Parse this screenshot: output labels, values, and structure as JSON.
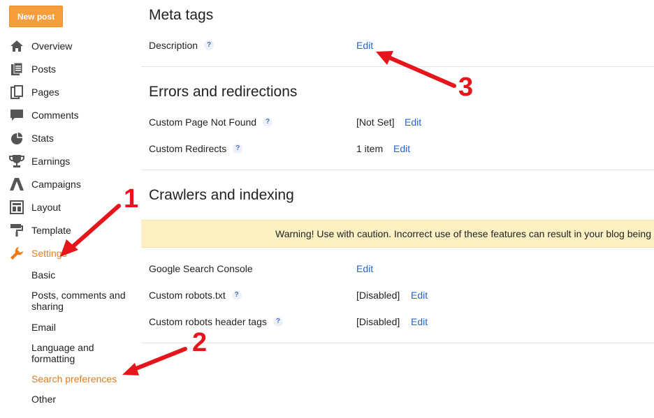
{
  "sidebar": {
    "new_post": "New post",
    "items": [
      {
        "label": "Overview",
        "icon": "home-icon"
      },
      {
        "label": "Posts",
        "icon": "posts-icon"
      },
      {
        "label": "Pages",
        "icon": "pages-icon"
      },
      {
        "label": "Comments",
        "icon": "comments-icon"
      },
      {
        "label": "Stats",
        "icon": "stats-icon"
      },
      {
        "label": "Earnings",
        "icon": "trophy-icon"
      },
      {
        "label": "Campaigns",
        "icon": "campaigns-icon"
      },
      {
        "label": "Layout",
        "icon": "layout-icon"
      },
      {
        "label": "Template",
        "icon": "paint-roller-icon"
      },
      {
        "label": "Settings",
        "icon": "wrench-icon"
      }
    ],
    "settings_sub": [
      "Basic",
      "Posts, comments and sharing",
      "Email",
      "Language and formatting",
      "Search preferences",
      "Other"
    ]
  },
  "main": {
    "meta_tags": {
      "title": "Meta tags",
      "description_label": "Description",
      "description_edit": "Edit"
    },
    "errors": {
      "title": "Errors and redirections",
      "not_found_label": "Custom Page Not Found",
      "not_found_value": "[Not Set]",
      "not_found_edit": "Edit",
      "redirects_label": "Custom Redirects",
      "redirects_value": "1 item",
      "redirects_edit": "Edit"
    },
    "crawlers": {
      "title": "Crawlers and indexing",
      "warning": "Warning! Use with caution. Incorrect use of these features can result in your blog being",
      "console_label": "Google Search Console",
      "console_edit": "Edit",
      "robots_label": "Custom robots.txt",
      "robots_value": "[Disabled]",
      "robots_edit": "Edit",
      "header_label": "Custom robots header tags",
      "header_value": "[Disabled]",
      "header_edit": "Edit"
    },
    "help_glyph": "?"
  },
  "annotations": {
    "n1": "1",
    "n2": "2",
    "n3": "3",
    "color": "#e6141b"
  },
  "colors": {
    "accent_orange": "#f69d3c",
    "link_blue": "#2a64c8",
    "warning_bg": "#fdf1c3"
  }
}
